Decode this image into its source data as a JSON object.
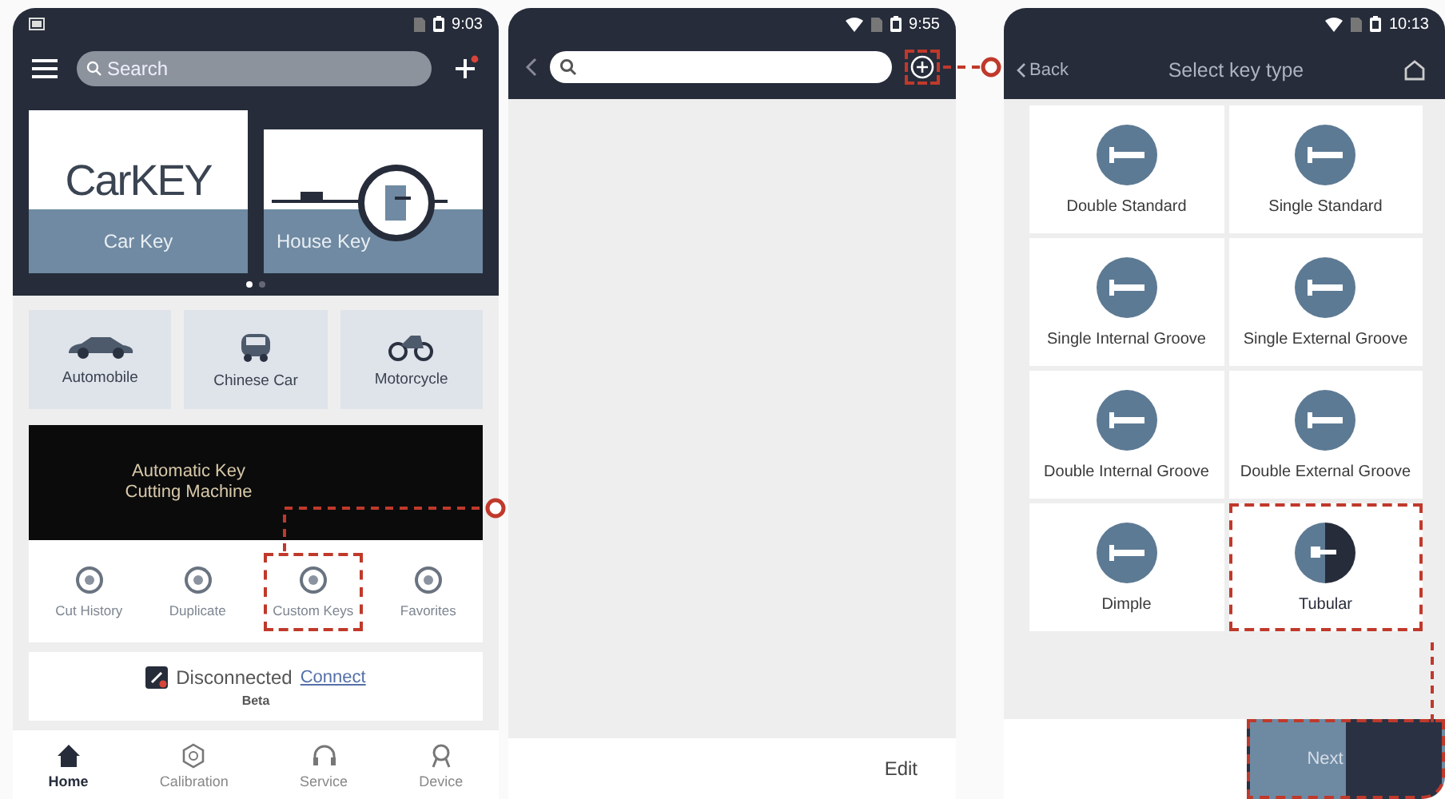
{
  "home_screen": {
    "status_time": "9:03",
    "search": {
      "placeholder": "Search"
    },
    "hero_cards": [
      {
        "kind": "car",
        "logo": "CarKEY",
        "label": "Car Key"
      },
      {
        "kind": "house",
        "label": "House Key"
      }
    ],
    "hero_pages": [
      {
        "selected": true
      },
      {
        "selected": false
      }
    ],
    "categories": [
      {
        "kind": "car",
        "label": "Automobile"
      },
      {
        "kind": "compact",
        "label": "Chinese Car"
      },
      {
        "kind": "moto",
        "label": "Motorcycle"
      }
    ],
    "banner": {
      "title": "Automatic Key Cutting Machine"
    },
    "tools": [
      {
        "label": "Cut History",
        "highlighted": false
      },
      {
        "label": "Duplicate",
        "highlighted": false
      },
      {
        "label": "Custom Keys",
        "highlighted": true
      },
      {
        "label": "Favorites",
        "highlighted": false
      }
    ],
    "connection": {
      "status": "Disconnected",
      "link": "Connect",
      "channel": "Beta"
    },
    "nav": [
      {
        "kind": "home",
        "label": "Home",
        "selected": true
      },
      {
        "kind": "calibration",
        "label": "Calibration",
        "selected": false
      },
      {
        "kind": "service",
        "label": "Service",
        "selected": false
      },
      {
        "kind": "device",
        "label": "Device",
        "selected": false
      }
    ]
  },
  "search_screen": {
    "status_time": "9:55",
    "wifi": true,
    "add_highlighted": true,
    "edit": "Edit"
  },
  "key_type_screen": {
    "status_time": "10:13",
    "wifi": true,
    "back": "Back",
    "title": "Select key type",
    "key_types": [
      {
        "kind": "flat",
        "label": "Double Standard",
        "selected": false
      },
      {
        "kind": "flat",
        "label": "Single Standard",
        "selected": false
      },
      {
        "kind": "flat",
        "label": "Single Internal Groove",
        "selected": false
      },
      {
        "kind": "flat",
        "label": "Single External Groove",
        "selected": false
      },
      {
        "kind": "flat",
        "label": "Double Internal Groove",
        "selected": false
      },
      {
        "kind": "flat",
        "label": "Double External Groove",
        "selected": false
      },
      {
        "kind": "flat",
        "label": "Dimple",
        "selected": false
      },
      {
        "kind": "tubular",
        "label": "Tubular",
        "selected": true
      }
    ],
    "next": "Next",
    "next_highlighted": true
  }
}
